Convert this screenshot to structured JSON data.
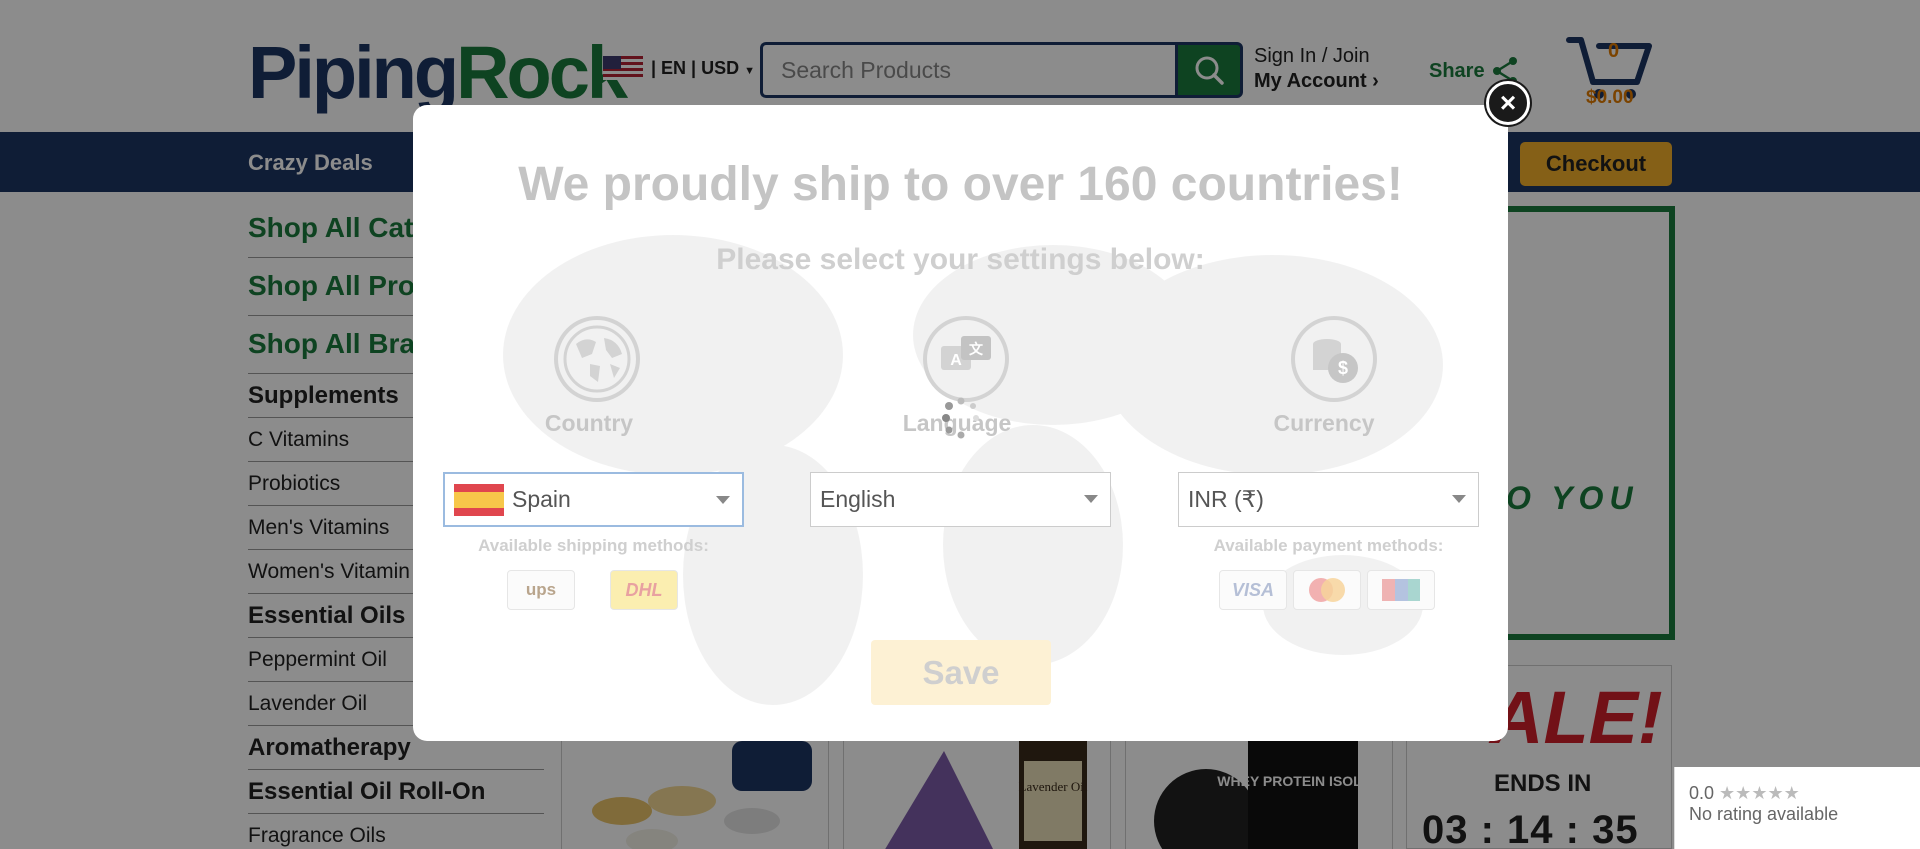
{
  "header": {
    "logo_part1": "Piping",
    "logo_part2": "Rock",
    "locale_text": "| EN | USD",
    "search_placeholder": "Search Products",
    "sign_in": "Sign In / Join",
    "my_account": "My Account",
    "share": "Share",
    "cart_count": "0",
    "cart_total": "$0.00"
  },
  "nav": {
    "crazy_deals": "Crazy Deals",
    "checkout": "Checkout"
  },
  "sidebar": {
    "items": [
      {
        "label": "Shop All Cat",
        "kind": "big"
      },
      {
        "label": "Shop All Pro",
        "kind": "big"
      },
      {
        "label": "Shop All Bra",
        "kind": "big"
      },
      {
        "label": "Supplements",
        "kind": "cat"
      },
      {
        "label": "C Vitamins",
        "kind": "sub"
      },
      {
        "label": "Probiotics",
        "kind": "sub"
      },
      {
        "label": "Men's Vitamins",
        "kind": "sub"
      },
      {
        "label": "Women's Vitamin",
        "kind": "sub"
      },
      {
        "label": "Essential Oils",
        "kind": "cat"
      },
      {
        "label": "Peppermint Oil",
        "kind": "sub"
      },
      {
        "label": "Lavender Oil",
        "kind": "sub"
      },
      {
        "label": "Aromatherapy",
        "kind": "cat"
      },
      {
        "label": "Essential Oil Roll-On",
        "kind": "cat"
      },
      {
        "label": "Fragrance Oils",
        "kind": "sub"
      }
    ]
  },
  "promo": {
    "banner_text": "O YOU",
    "sale_text": "ALE!",
    "ends_in": "ENDS IN",
    "timer": "03 : 14 : 35"
  },
  "products": {
    "p2_label": "Lavender Oil",
    "p3_label": "WHEY PROTEIN ISOLATE"
  },
  "rating": {
    "score": "0.0",
    "stars": "★★★★★",
    "text": "No rating available"
  },
  "modal": {
    "close": "×",
    "title": "We proudly ship to over 160 countries!",
    "subtitle": "Please select your settings below:",
    "country_label": "Country",
    "language_label": "Language",
    "currency_label": "Currency",
    "country_value": "Spain",
    "language_value": "English",
    "currency_value": "INR (₹)",
    "shipping_methods": "Available shipping methods:",
    "payment_methods": "Available payment methods:",
    "ship_ups": "ups",
    "ship_dhl": "DHL",
    "pay_visa": "VISA",
    "save": "Save"
  },
  "colors": {
    "brand_navy": "#1d3563",
    "brand_green": "#1b7a3c",
    "checkout_yellow": "#f2b02a",
    "sale_red": "#d0202b"
  }
}
